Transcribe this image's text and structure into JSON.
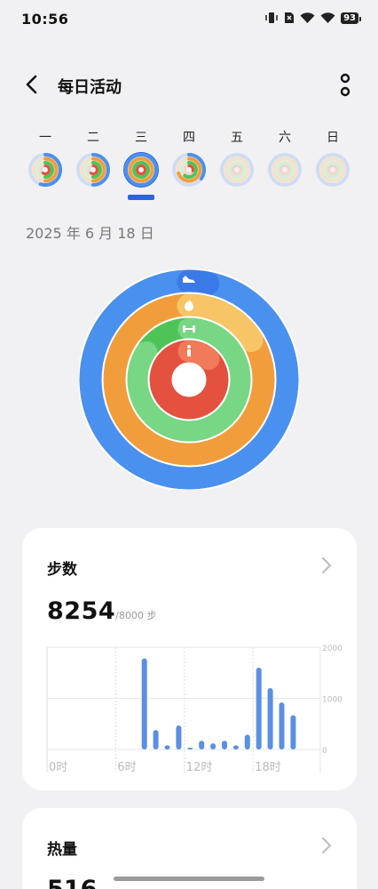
{
  "status_bar": {
    "time": "10:56",
    "battery": "93"
  },
  "header": {
    "title": "每日活动"
  },
  "week": {
    "days": [
      {
        "label": "一",
        "selected": false,
        "move": 0.55,
        "cal": 0.5,
        "ex": 0.5,
        "stand": 0.6
      },
      {
        "label": "二",
        "selected": false,
        "move": 0.5,
        "cal": 0.5,
        "ex": 0.5,
        "stand": 0.6
      },
      {
        "label": "三",
        "selected": true,
        "move": 1.0,
        "cal": 1.0,
        "ex": 1.0,
        "stand": 1.0
      },
      {
        "label": "四",
        "selected": false,
        "move": 0.35,
        "cal": 0.7,
        "ex": 0.6,
        "stand": 0.3
      },
      {
        "label": "五",
        "selected": false,
        "move": 0,
        "cal": 0,
        "ex": 0,
        "stand": 0
      },
      {
        "label": "六",
        "selected": false,
        "move": 0,
        "cal": 0,
        "ex": 0,
        "stand": 0
      },
      {
        "label": "日",
        "selected": false,
        "move": 0,
        "cal": 0,
        "ex": 0,
        "stand": 0
      }
    ]
  },
  "date": "2025 年 6 月 18 日",
  "rings": {
    "steps_progress": 1.03,
    "calories_progress": 1.16,
    "exercise_progress": 0.84,
    "stand_progress": 1.12,
    "icons": [
      "shoe-icon",
      "flame-icon",
      "dumbbell-icon",
      "person-icon"
    ],
    "colors": {
      "steps": "#4a90ee",
      "steps_dark": "#3a7ae8",
      "calories": "#f29d3c",
      "calories_light": "#f7c566",
      "exercise": "#4ec457",
      "exercise_light": "#7cd98a",
      "stand": "#e4513f",
      "stand_light": "#f07a5a"
    }
  },
  "steps_card": {
    "title": "步数",
    "value": "8254",
    "goal": "/8000 步",
    "chart_data": {
      "type": "bar",
      "ylim": [
        0,
        2000
      ],
      "y_ticks": [
        "2000",
        "1000",
        "0"
      ],
      "x_tick_labels": [
        "0时",
        "6时",
        "12时",
        "18时"
      ],
      "bars": [
        {
          "hour": 8,
          "value": 1780
        },
        {
          "hour": 9,
          "value": 380
        },
        {
          "hour": 10,
          "value": 80
        },
        {
          "hour": 11,
          "value": 470
        },
        {
          "hour": 12,
          "value": 20
        },
        {
          "hour": 13,
          "value": 170
        },
        {
          "hour": 14,
          "value": 120
        },
        {
          "hour": 15,
          "value": 170
        },
        {
          "hour": 16,
          "value": 80
        },
        {
          "hour": 17,
          "value": 290
        },
        {
          "hour": 18,
          "value": 1600
        },
        {
          "hour": 19,
          "value": 1200
        },
        {
          "hour": 20,
          "value": 920
        },
        {
          "hour": 21,
          "value": 670
        }
      ],
      "bar_color": "#5b8fe3"
    }
  },
  "calories_card": {
    "title": "热量",
    "value": "516"
  }
}
